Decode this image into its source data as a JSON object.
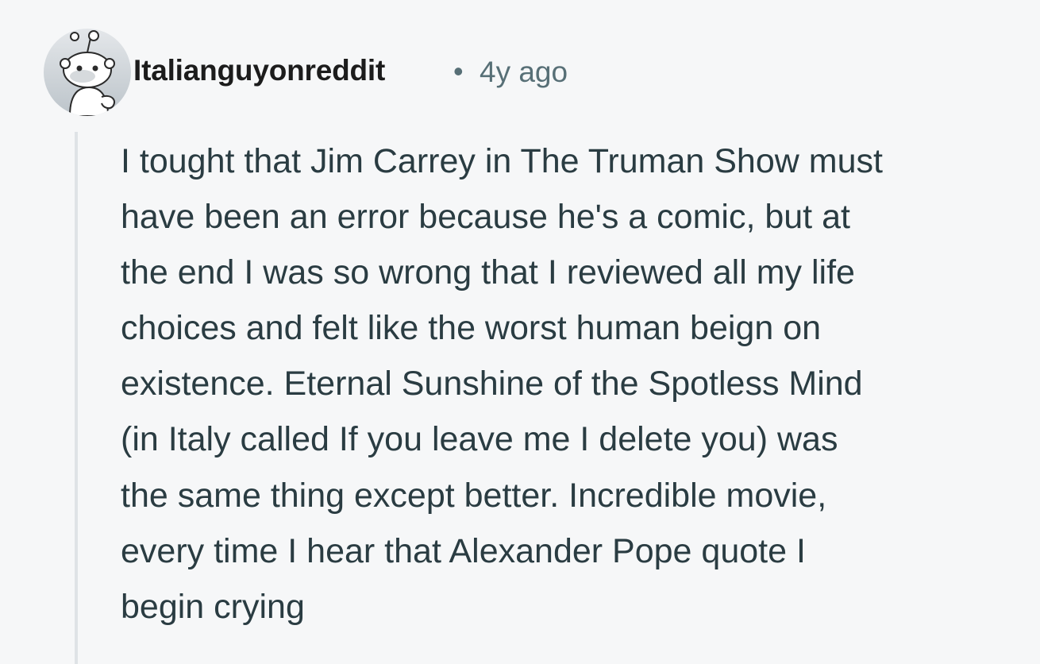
{
  "comment": {
    "author": "Italianguyonreddit",
    "separator": "•",
    "timestamp": "4y ago",
    "avatar_icon": "snoo-avatar-icon",
    "body_lines": [
      "I tought that Jim Carrey in The Truman Show must",
      "have been an error because he's a comic, but at",
      "the end I was so wrong that I reviewed all my life",
      "choices and felt like the worst human beign on",
      "existence. Eternal Sunshine of the Spotless Mind",
      "(in Italy called If you leave me I delete you) was",
      "the same thing except better. Incredible movie,",
      "every time I hear that Alexander Pope quote I",
      "begin crying"
    ]
  },
  "colors": {
    "background": "#f6f7f8",
    "username": "#1c1c1c",
    "meta": "#576f76",
    "body": "#2a3c42",
    "thread_line": "#dfe3e6"
  }
}
